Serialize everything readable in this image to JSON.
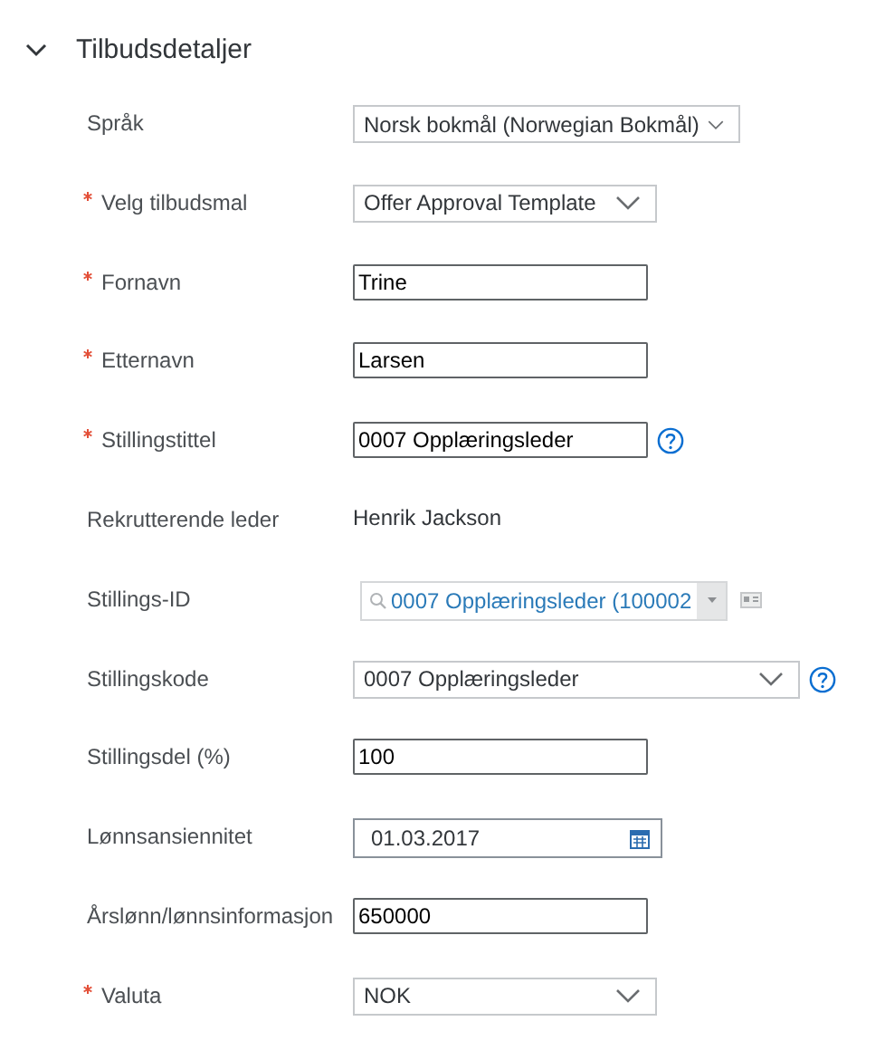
{
  "section": {
    "title": "Tilbudsdetaljer",
    "expanded": true
  },
  "fields": [
    {
      "kind": "select",
      "label": "Språk",
      "required": false,
      "value": "Norsk bokmål (Norwegian Bokmål)",
      "help": false
    },
    {
      "kind": "select",
      "label": "Velg tilbudsmal",
      "required": true,
      "value": "Offer Approval Template",
      "help": false
    },
    {
      "kind": "text",
      "label": "Fornavn",
      "required": true,
      "value": "Trine",
      "help": false
    },
    {
      "kind": "text",
      "label": "Etternavn",
      "required": true,
      "value": "Larsen",
      "help": false
    },
    {
      "kind": "text",
      "label": "Stillingstittel",
      "required": true,
      "value": "0007 Opplæringsleder",
      "help": true
    },
    {
      "kind": "static",
      "label": "Rekrutterende leder",
      "required": false,
      "value": "Henrik Jackson",
      "help": false
    },
    {
      "kind": "lookup",
      "label": "Stillings-ID",
      "required": false,
      "value": "0007 Opplæringsleder (100002",
      "help": false
    },
    {
      "kind": "select",
      "label": "Stillingskode",
      "required": false,
      "value": "0007 Opplæringsleder",
      "help": true
    },
    {
      "kind": "text",
      "label": "Stillingsdel (%)",
      "required": false,
      "value": "100",
      "help": false
    },
    {
      "kind": "date",
      "label": "Lønnsansiennitet",
      "required": false,
      "value": "01.03.2017",
      "help": false
    },
    {
      "kind": "text",
      "label": "Årslønn/lønnsinformasjon",
      "required": false,
      "value": "650000",
      "help": false
    },
    {
      "kind": "select",
      "label": "Valuta",
      "required": true,
      "value": "NOK",
      "help": false
    }
  ]
}
